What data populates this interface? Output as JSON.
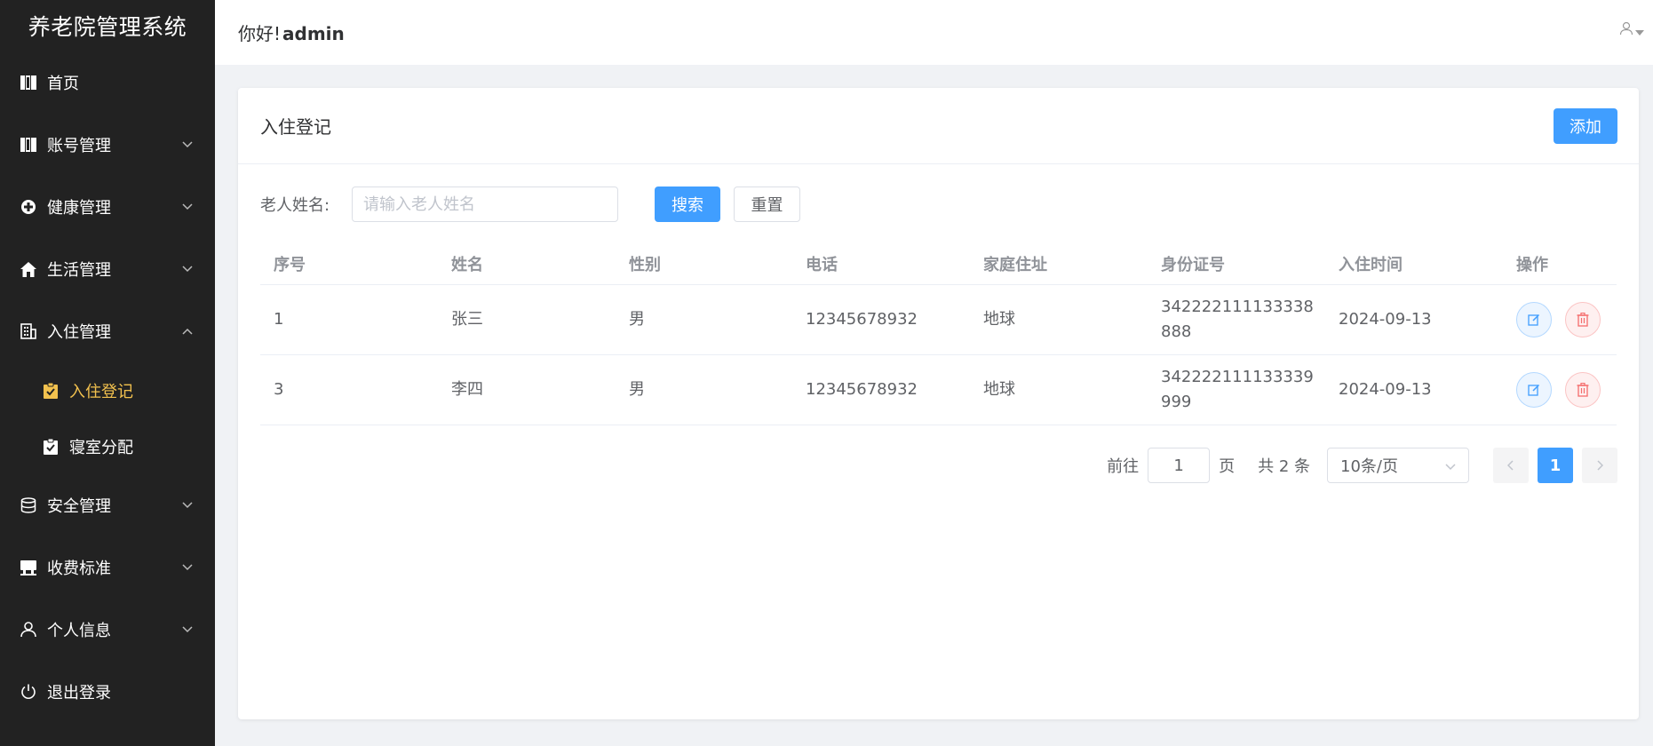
{
  "app": {
    "title": "养老院管理系统"
  },
  "header": {
    "greeting": "你好!",
    "username": "admin"
  },
  "sidebar": {
    "items": [
      {
        "label": "首页"
      },
      {
        "label": "账号管理"
      },
      {
        "label": "健康管理"
      },
      {
        "label": "生活管理"
      },
      {
        "label": "入住管理"
      },
      {
        "label": "入住登记"
      },
      {
        "label": "寝室分配"
      },
      {
        "label": "安全管理"
      },
      {
        "label": "收费标准"
      },
      {
        "label": "个人信息"
      },
      {
        "label": "退出登录"
      }
    ]
  },
  "card": {
    "title": "入住登记",
    "add_label": "添加"
  },
  "search": {
    "label": "老人姓名:",
    "placeholder": "请输入老人姓名",
    "value": "",
    "search_label": "搜索",
    "reset_label": "重置"
  },
  "table": {
    "headers": [
      "序号",
      "姓名",
      "性别",
      "电话",
      "家庭住址",
      "身份证号",
      "入住时间",
      "操作"
    ],
    "rows": [
      {
        "id": "1",
        "name": "张三",
        "gender": "男",
        "phone": "12345678932",
        "address": "地球",
        "idcard": "342222111133338888",
        "checkin": "2024-09-13"
      },
      {
        "id": "3",
        "name": "李四",
        "gender": "男",
        "phone": "12345678932",
        "address": "地球",
        "idcard": "342222111133339999",
        "checkin": "2024-09-13"
      }
    ]
  },
  "pagination": {
    "goto_label": "前往",
    "goto_value": "1",
    "page_unit": "页",
    "total_text": "共 2 条",
    "page_size": "10条/页",
    "current_page": "1"
  },
  "colors": {
    "primary": "#409eff",
    "sidebar_bg": "#222222",
    "active_menu": "#f2c14e",
    "danger": "#f56c6c"
  }
}
